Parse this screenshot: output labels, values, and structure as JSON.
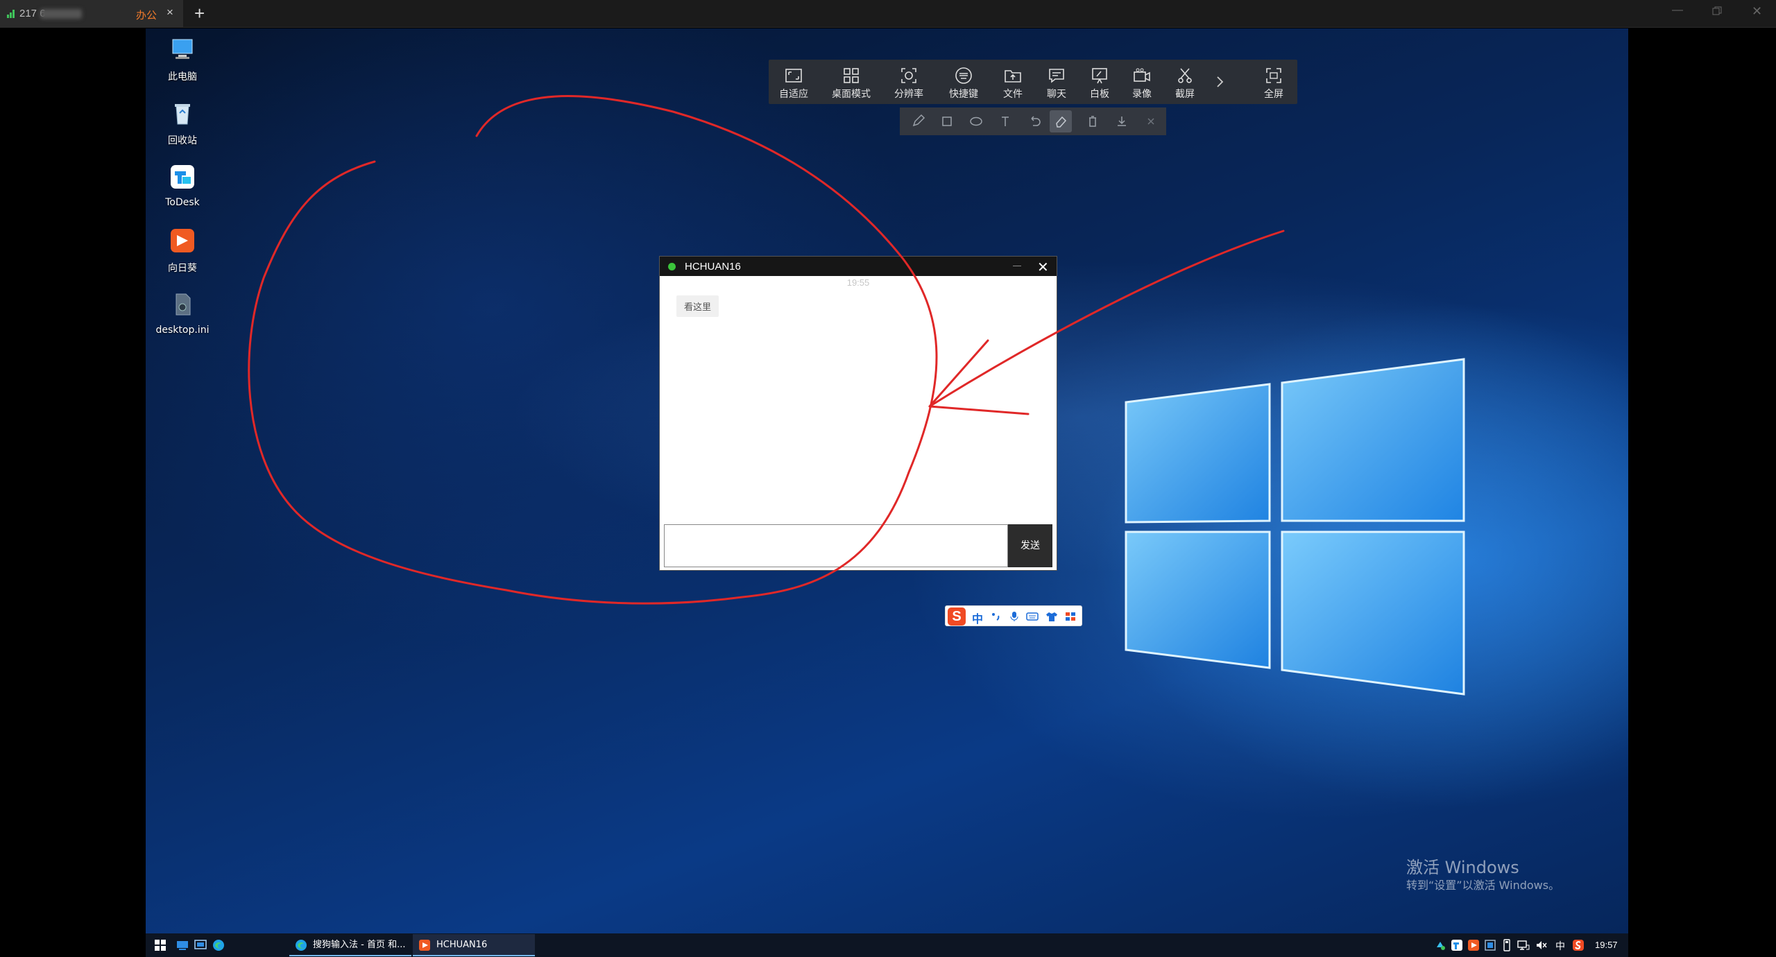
{
  "host": {
    "tab_id": "217 6",
    "tab_name": "办公",
    "tab_close": "×",
    "new_tab": "+"
  },
  "desktop_icons": [
    {
      "label": "此电脑",
      "icon": "this-pc-icon"
    },
    {
      "label": "回收站",
      "icon": "recycle-bin-icon"
    },
    {
      "label": "ToDesk",
      "icon": "todesk-icon"
    },
    {
      "label": "向日葵",
      "icon": "sunlogin-icon"
    },
    {
      "label": "desktop.ini",
      "icon": "ini-file-icon"
    }
  ],
  "toolbar": {
    "buttons": [
      {
        "label": "自适应",
        "icon": "fit-screen-icon"
      },
      {
        "label": "桌面模式",
        "icon": "desktop-grid-icon"
      },
      {
        "label": "分辨率",
        "icon": "resolution-icon"
      },
      {
        "label": "快捷键",
        "icon": "keyboard-icon"
      },
      {
        "label": "文件",
        "icon": "file-transfer-icon"
      },
      {
        "label": "聊天",
        "icon": "chat-icon"
      },
      {
        "label": "白板",
        "icon": "whiteboard-icon"
      },
      {
        "label": "录像",
        "icon": "record-icon"
      },
      {
        "label": "截屏",
        "icon": "scissors-icon"
      },
      {
        "label": "全屏",
        "icon": "fullscreen-icon"
      }
    ]
  },
  "draw_tools": [
    "pen",
    "rectangle",
    "ellipse",
    "text",
    "undo",
    "eraser",
    "delete",
    "save",
    "close"
  ],
  "chat": {
    "title": "HCHUAN16",
    "time": "19:55",
    "message": "看这里",
    "send_label": "发送",
    "close": "✕"
  },
  "ime": {
    "logo": "S",
    "language": "中"
  },
  "activation": {
    "title": "激活 Windows",
    "subtitle": "转到“设置”以激活 Windows。"
  },
  "taskbar": {
    "apps": [
      {
        "label": "搜狗输入法 - 首页 和...",
        "icon": "edge-icon"
      },
      {
        "label": "HCHUAN16",
        "icon": "sunlogin-icon"
      }
    ],
    "lang": "中",
    "time": "19:57"
  },
  "colors": {
    "annotation_red": "#e02828",
    "toolbar_bg": "#2b2f36",
    "accent_orange": "#f07a2b"
  }
}
